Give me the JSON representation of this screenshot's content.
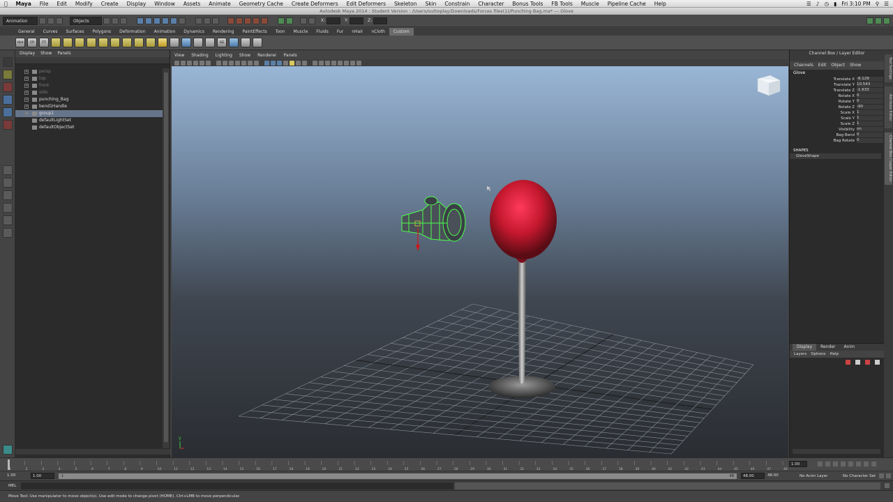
{
  "macbar": {
    "app": "Maya",
    "menus": [
      "File",
      "Edit",
      "Modify",
      "Create",
      "Display",
      "Window",
      "Assets",
      "Animate",
      "Geometry Cache",
      "Create Deformers",
      "Edit Deformers",
      "Skeleton",
      "Skin",
      "Constrain",
      "Character",
      "Bonus Tools",
      "FB Tools",
      "Muscle",
      "Pipeline Cache",
      "Help"
    ],
    "clock": "Fri 3:10 PM"
  },
  "window_title": "Autodesk Maya 2014 : Student Version : /Users/outtoplay/Downloads/Forces files(1)/Punching Bag.ma*   ---   Glove",
  "statusline": {
    "mode": "Animation",
    "objects_label": "Objects",
    "x_label": "X:",
    "y_label": "Y:",
    "z_label": "Z:"
  },
  "shelf": {
    "tabs": [
      "General",
      "Curves",
      "Surfaces",
      "Polygons",
      "Deformation",
      "Animation",
      "Dynamics",
      "Rendering",
      "PaintEffects",
      "Toon",
      "Muscle",
      "Fluids",
      "Fur",
      "nHair",
      "nCloth",
      "Custom"
    ],
    "active_tab": "Custom",
    "icon_labels": [
      "Hist",
      "CP",
      "FT",
      "",
      "",
      "",
      "",
      "",
      "",
      "",
      "",
      "",
      "",
      "",
      "",
      "",
      "",
      "",
      "GE",
      "",
      ""
    ]
  },
  "outliner": {
    "menu": [
      "Display",
      "Show",
      "Panels"
    ],
    "items": [
      {
        "label": "persp",
        "state": "dim"
      },
      {
        "label": "top",
        "state": "dim"
      },
      {
        "label": "front",
        "state": "dim"
      },
      {
        "label": "side",
        "state": "dim"
      },
      {
        "label": "punching_Bag",
        "state": "normal"
      },
      {
        "label": "bend1Handle",
        "state": "normal"
      },
      {
        "label": "group1",
        "state": "selected"
      },
      {
        "label": "defaultLightSet",
        "state": "normal"
      },
      {
        "label": "defaultObjectSet",
        "state": "normal"
      }
    ]
  },
  "viewport": {
    "menu": [
      "View",
      "Shading",
      "Lighting",
      "Show",
      "Renderer",
      "Panels"
    ]
  },
  "channelbox": {
    "title": "Channel Box / Layer Editor",
    "menu": [
      "Channels",
      "Edit",
      "Object",
      "Show"
    ],
    "object": "Glove",
    "attributes": [
      {
        "label": "Translate X",
        "value": "-8.129"
      },
      {
        "label": "Translate Y",
        "value": "10.543"
      },
      {
        "label": "Translate Z",
        "value": "-1.633"
      },
      {
        "label": "Rotate X",
        "value": "0"
      },
      {
        "label": "Rotate Y",
        "value": "0"
      },
      {
        "label": "Rotate Z",
        "value": "-90"
      },
      {
        "label": "Scale X",
        "value": "1"
      },
      {
        "label": "Scale Y",
        "value": "1"
      },
      {
        "label": "Scale Z",
        "value": "1"
      },
      {
        "label": "Visibility",
        "value": "on"
      },
      {
        "label": "Bag Bend",
        "value": "0"
      },
      {
        "label": "Bag Rotate",
        "value": "0"
      }
    ],
    "shapes_header": "SHAPES",
    "shape": "GloveShape"
  },
  "sidetabs": [
    "Tool Settings",
    "Attribute Editor",
    "Channel Box / Layer Editor"
  ],
  "layer": {
    "tabs": [
      "Display",
      "Render",
      "Anim"
    ],
    "active": "Display",
    "menu": [
      "Layers",
      "Options",
      "Help"
    ]
  },
  "timeline": {
    "ticks": [
      "1",
      "2",
      "3",
      "4",
      "5",
      "6",
      "7",
      "8",
      "9",
      "10",
      "11",
      "12",
      "13",
      "14",
      "15",
      "16",
      "17",
      "18",
      "19",
      "20",
      "21",
      "22",
      "23",
      "24",
      "25",
      "26",
      "27",
      "28",
      "29",
      "30",
      "31",
      "32",
      "33",
      "34",
      "35",
      "36",
      "37",
      "38",
      "39",
      "40",
      "41",
      "42",
      "43",
      "44",
      "45",
      "46",
      "47",
      "48"
    ],
    "current": "1.00"
  },
  "range": {
    "start": "1.00",
    "inner_start": "1.00",
    "inner_slider_value": "1",
    "slider_end": "48",
    "end": "48.00",
    "anim_end": "48.00",
    "anim_layer": "No Anim Layer",
    "character_set": "No Character Set"
  },
  "cmdline": {
    "label": "MEL"
  },
  "helpline": "Move Tool: Use manipulator to move object(s). Use edit mode to change pivot (HOME). Ctrl+LMB to move perpendicular."
}
